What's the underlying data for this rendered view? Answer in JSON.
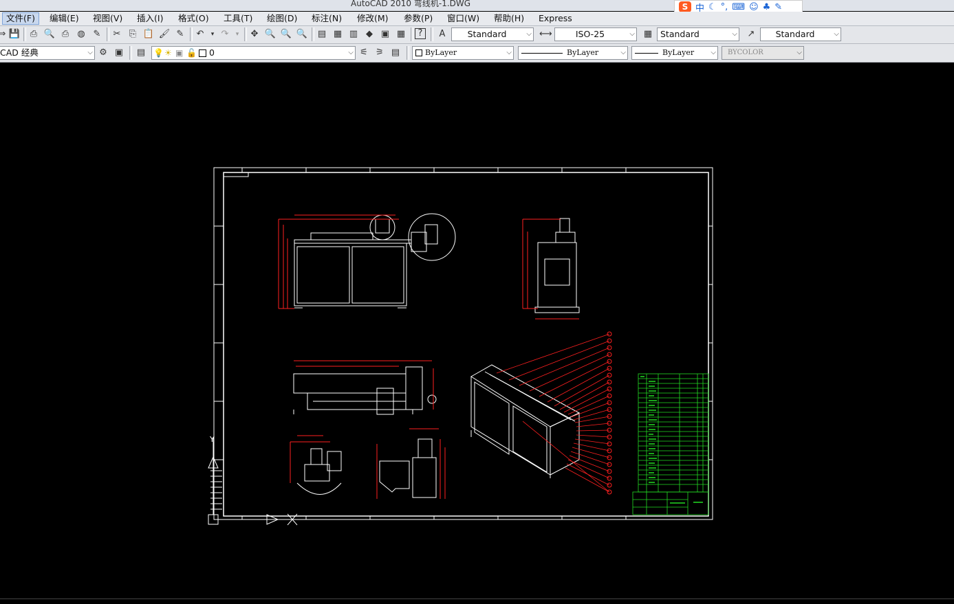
{
  "window": {
    "title": "AutoCAD 2010      弯线机-1.DWG"
  },
  "ime": {
    "logo": "S",
    "mode": "中"
  },
  "menu": [
    "文件(F)",
    "编辑(E)",
    "视图(V)",
    "插入(I)",
    "格式(O)",
    "工具(T)",
    "绘图(D)",
    "标注(N)",
    "修改(M)",
    "参数(P)",
    "窗口(W)",
    "帮助(H)",
    "Express"
  ],
  "styles": {
    "text_style": "Standard",
    "dim_style": "ISO-25",
    "table_style": "Standard",
    "multileader_style": "Standard"
  },
  "workspace": "CAD 经典",
  "layer": {
    "name": "0"
  },
  "properties": {
    "color": "ByLayer",
    "linetype": "ByLayer",
    "lineweight": "ByLayer",
    "plotstyle": "BYCOLOR"
  },
  "colors": {
    "canvas": "#000000",
    "geometry": "#ffffff",
    "dimensions": "#ff2020",
    "title_block": "#22dd22"
  },
  "drawing": {
    "ucs_axis_y": "Y"
  }
}
